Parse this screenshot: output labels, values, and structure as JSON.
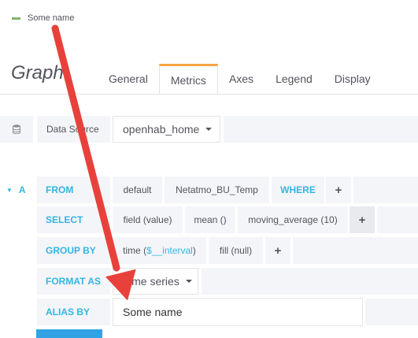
{
  "legend": {
    "series_name": "Some name",
    "color": "#7eb26d"
  },
  "panel": {
    "title": "Graph"
  },
  "tabs": [
    {
      "label": "General",
      "active": false
    },
    {
      "label": "Metrics",
      "active": true
    },
    {
      "label": "Axes",
      "active": false
    },
    {
      "label": "Legend",
      "active": false
    },
    {
      "label": "Display",
      "active": false
    }
  ],
  "datasource": {
    "label": "Data Source",
    "value": "openhab_home"
  },
  "query": {
    "ref_id": "A",
    "from": {
      "keyword": "FROM",
      "policy": "default",
      "measurement": "Netatmo_BU_Temp",
      "where_keyword": "WHERE"
    },
    "select": {
      "keyword": "SELECT",
      "parts": [
        "field (value)",
        "mean ()",
        "moving_average (10)"
      ]
    },
    "group_by": {
      "keyword": "GROUP BY",
      "time_prefix": "time (",
      "time_var": "$__interval",
      "time_suffix": ")",
      "fill": "fill (null)"
    },
    "format_as": {
      "keyword": "FORMAT AS",
      "value": "Time series"
    },
    "alias_by": {
      "keyword": "ALIAS BY",
      "value": "Some name"
    }
  },
  "colors": {
    "keyword": "#33b5e5",
    "active_tab_border": "#f5a542",
    "arrow": "#e8413c",
    "series": "#7eb26d"
  }
}
